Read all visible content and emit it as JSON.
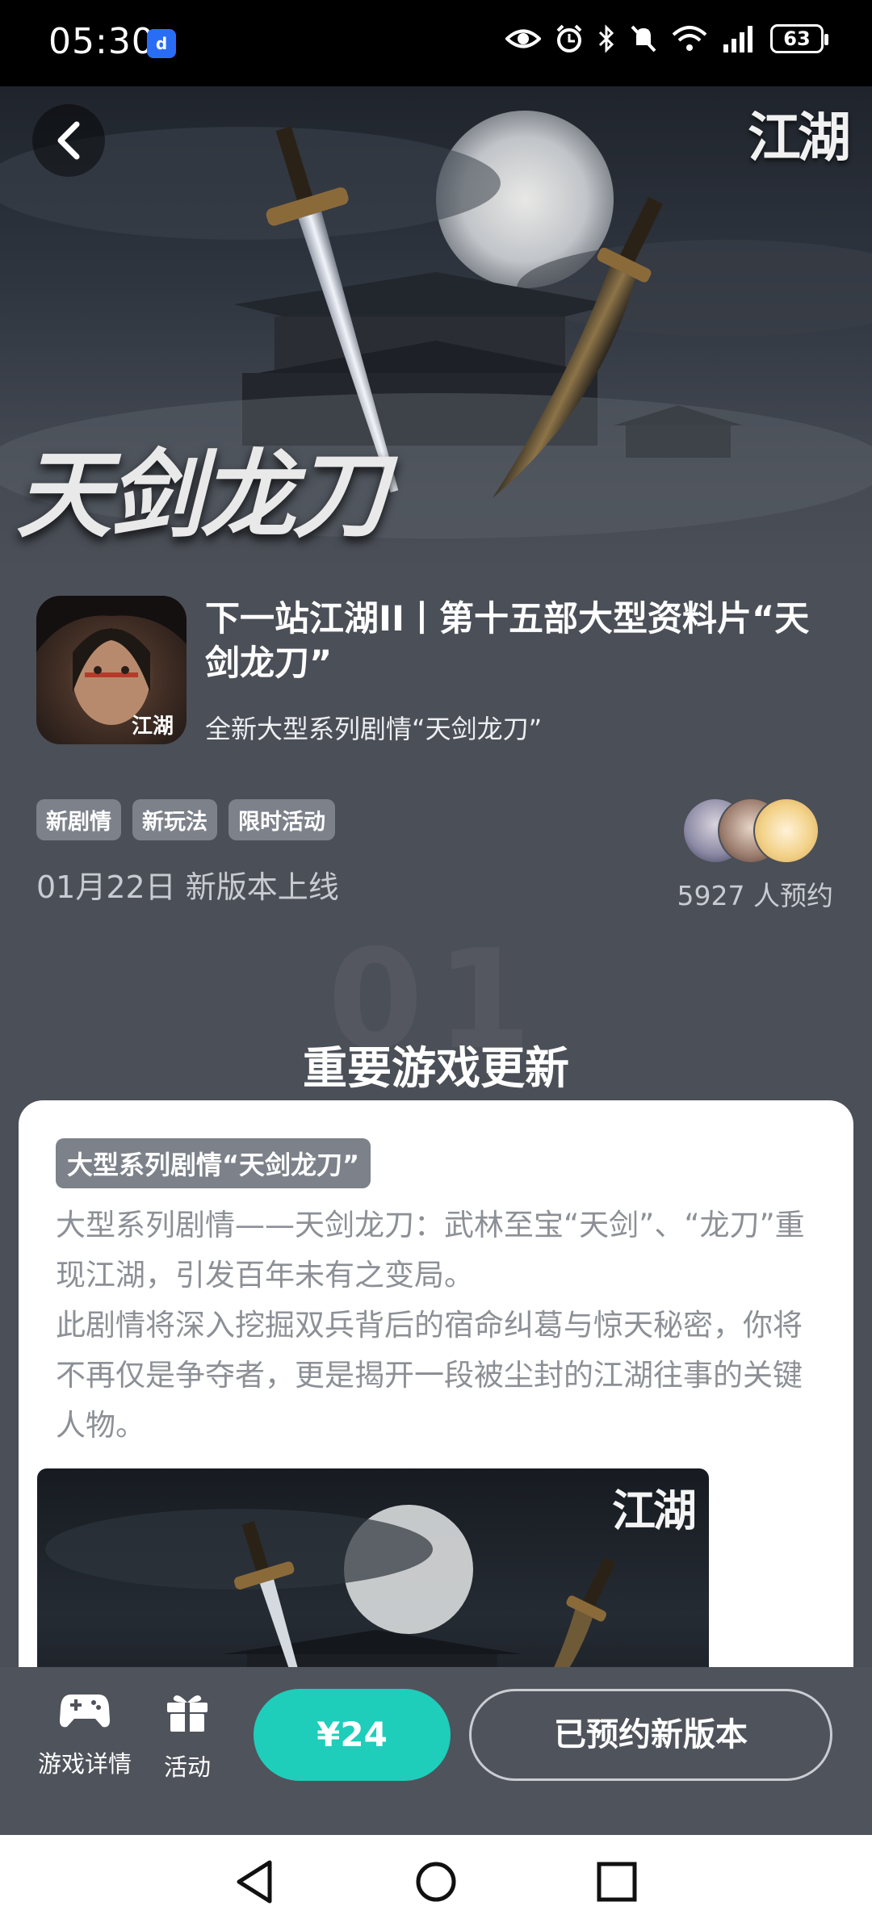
{
  "status_bar": {
    "time": "05:30",
    "battery": "63",
    "icons": [
      "eye-icon",
      "alarm-icon",
      "bluetooth-icon",
      "mute-icon",
      "wifi-icon",
      "signal-icon"
    ]
  },
  "hero": {
    "logo": "江湖",
    "title": "天剑龙刀"
  },
  "header": {
    "title": "下一站江湖II丨第十五部大型资料片“天剑龙刀”",
    "subtitle": "全新大型系列剧情“天剑龙刀”",
    "tags": [
      "新剧情",
      "新玩法",
      "限时活动"
    ],
    "release": "01月22日 新版本上线",
    "reservations": "5927 人预约"
  },
  "section": {
    "number": "01",
    "title": "重要游戏更新"
  },
  "card": {
    "badge": "大型系列剧情“天剑龙刀”",
    "paragraph1": "大型系列剧情——天剑龙刀：武林至宝“天剑”、“龙刀”重现江湖，引发百年未有之变局。",
    "paragraph2": "此剧情将深入挖掘双兵背后的宿命纠葛与惊天秘密，你将不再仅是争夺者，更是揭开一段被尘封的江湖往事的关键人物。",
    "image_logo": "江湖"
  },
  "action_bar": {
    "game_details": "游戏详情",
    "activity": "活动",
    "price": "¥24",
    "reserved": "已预约新版本"
  },
  "colors": {
    "accent": "#1fcdbb",
    "background": "#4b4f57",
    "tag": "#7c818a"
  }
}
